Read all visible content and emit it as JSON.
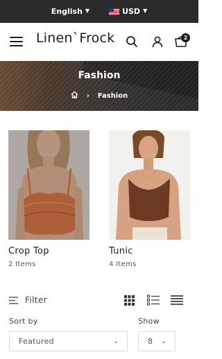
{
  "topbar": {
    "language": "English",
    "currency": "USD",
    "currency_flag": "us-flag-icon"
  },
  "header": {
    "logo": "Linen`Frock",
    "cart_count": "2",
    "icons": [
      "menu-icon",
      "search-icon",
      "user-icon",
      "cart-icon"
    ]
  },
  "banner": {
    "title": "Fashion",
    "breadcrumb_current": "Fashion"
  },
  "categories": [
    {
      "name": "Crop Top",
      "count": "2 Items",
      "dress_color": "#d9703f"
    },
    {
      "name": "Tunic",
      "count": "4 Items",
      "dress_color": "#6b3a22"
    }
  ],
  "toolbar": {
    "filter_label": "Filter",
    "sort_label": "Sort by",
    "sort_value": "Featured",
    "show_label": "Show",
    "show_value": "8"
  },
  "colors": {
    "topbar_bg": "#2b2b2b",
    "text": "#1c1c1c"
  }
}
